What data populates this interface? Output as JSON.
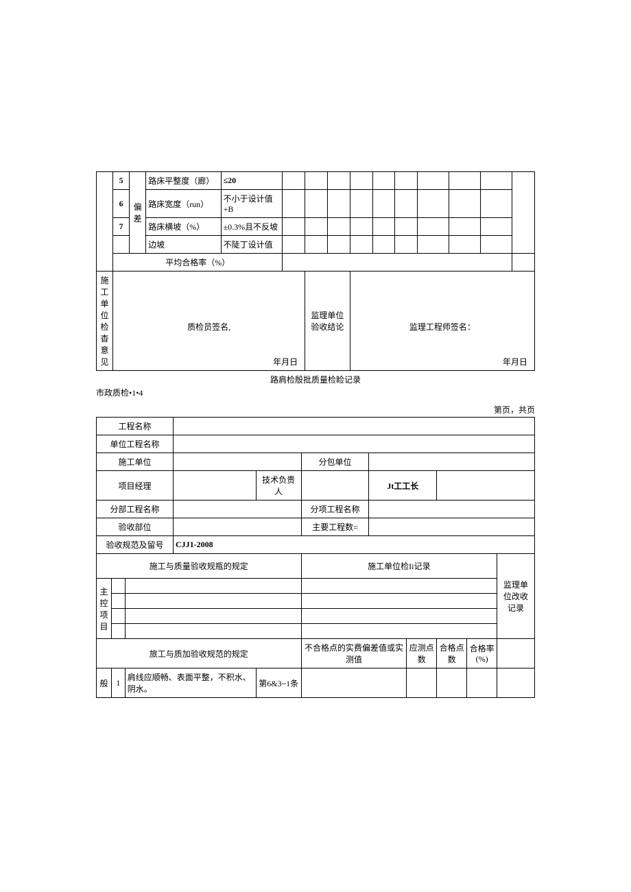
{
  "table1": {
    "col_dev": "偏差",
    "rows": [
      {
        "num": "5",
        "name": "路床平整度（廊）",
        "spec": "≤20"
      },
      {
        "num": "6",
        "name": "路床宽度（run）",
        "spec": "不小于设计值+B"
      },
      {
        "num": "7",
        "name": "路床横坡（%）",
        "spec": "±0.3%且不反坡"
      },
      {
        "num": "",
        "name": "边坡",
        "spec": "不陡丁设计值"
      }
    ],
    "avg_label": "平均合格率（%）",
    "left_block": "施工单位检杳意见",
    "left_sig": "质检员签名,",
    "left_date": "年月日",
    "right_block": "监理单位验收结论",
    "right_sig": "监理工程师签名：",
    "right_date": "年月日"
  },
  "mid": {
    "title": "路肩检殷批质量检睑记录",
    "code": "市政质检•1•4",
    "page": "第页，共页"
  },
  "table2": {
    "r1": "工程名称",
    "r2": "单位工程名称",
    "r3a": "施工单位",
    "r3b": "分包单位",
    "r4a": "项目经理",
    "r4b": "技术负贵人",
    "r4c": "Jt工工长",
    "r5a": "分部工程名称",
    "r5b": "分项工程名称",
    "r6a": "验收部位",
    "r6b": "主要工程数=",
    "r7a": "验收规范及留号",
    "r7b": "CJJ1-2008",
    "h1": "施工与质量验收规瓶的规定",
    "h2": "施工单位检Ii记录",
    "h3": "监理单位改收记录",
    "main_ctrl": "主控项目",
    "h4": "旅工与质加验收规范的规定",
    "h5": "不合格点的实费偏差值或实测值",
    "h6": "应测点数",
    "h7": "合格点数",
    "h8": "合格率(%)",
    "general": "般",
    "gen_row": {
      "num": "1",
      "text": "肩线应顺畅、表面平整，不积水、阴水。",
      "ref": "第6&3~1条"
    }
  }
}
